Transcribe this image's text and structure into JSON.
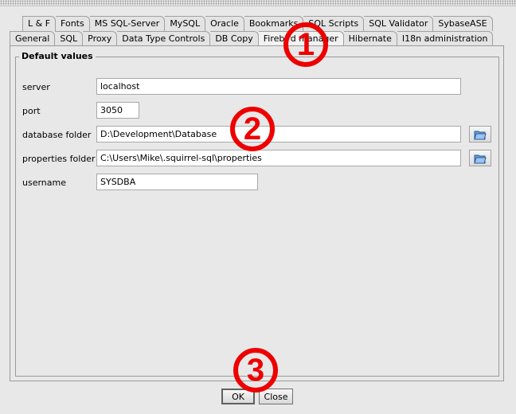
{
  "tabs_row1": [
    "L & F",
    "Fonts",
    "MS SQL-Server",
    "MySQL",
    "Oracle",
    "Bookmarks",
    "SQL Scripts",
    "SQL Validator",
    "SybaseASE"
  ],
  "tabs_row2": [
    "General",
    "SQL",
    "Proxy",
    "Data Type Controls",
    "DB Copy",
    "Firebird manager",
    "Hibernate",
    "I18n administration"
  ],
  "selected_tab": "Firebird manager",
  "group_title": "Default values",
  "fields": {
    "server": {
      "label": "server",
      "value": "localhost"
    },
    "port": {
      "label": "port",
      "value": "3050"
    },
    "database_folder": {
      "label": "database folder",
      "value": "D:\\Development\\Database"
    },
    "properties_folder": {
      "label": "properties folder",
      "value": "C:\\Users\\Mike\\.squirrel-sql\\properties"
    },
    "username": {
      "label": "username",
      "value": "SYSDBA"
    }
  },
  "buttons": {
    "ok": "OK",
    "close": "Close"
  },
  "annotations": [
    "1",
    "2",
    "3"
  ],
  "colors": {
    "annotation": "#ee0000"
  }
}
